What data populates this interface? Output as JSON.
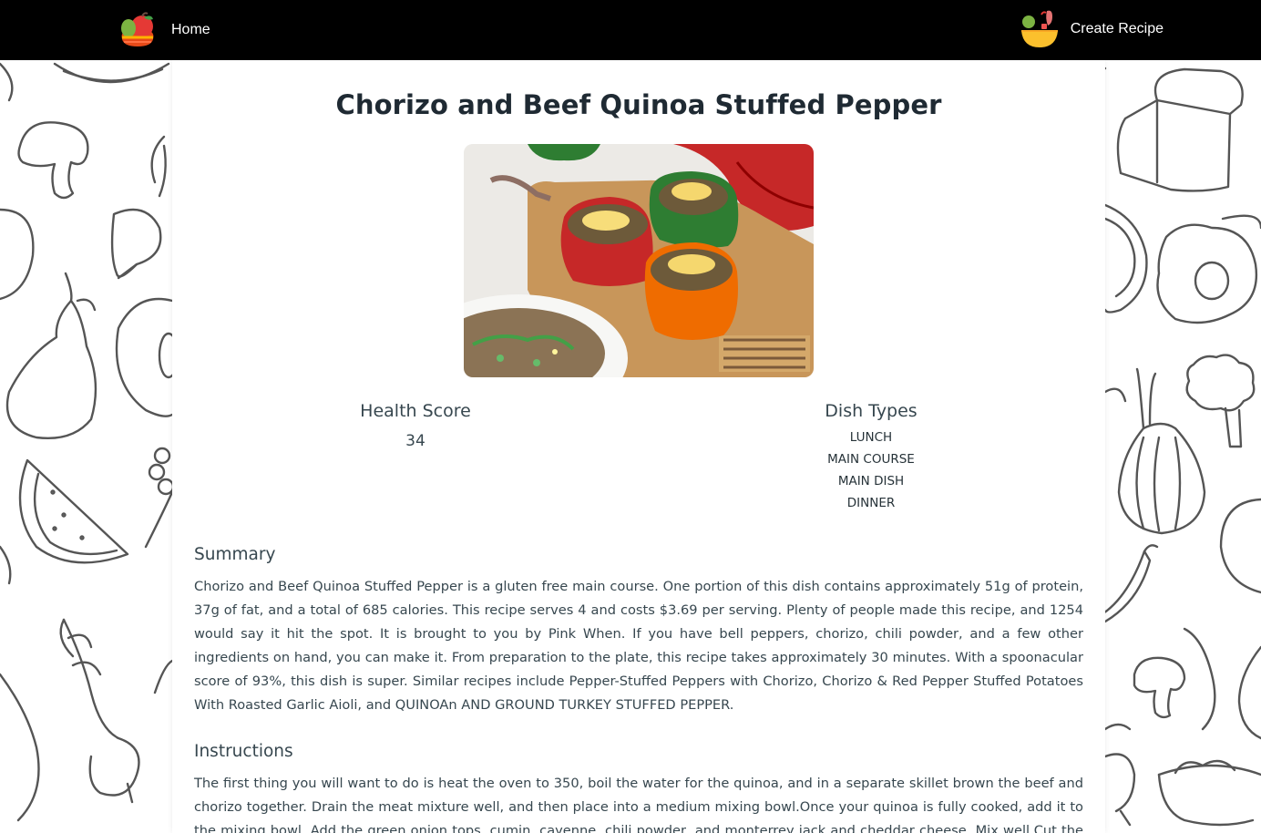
{
  "nav": {
    "home_label": "Home",
    "create_label": "Create Recipe"
  },
  "recipe": {
    "title": "Chorizo and Beef Quinoa Stuffed Pepper",
    "image_alt": "stuffed peppers",
    "health_score_label": "Health Score",
    "health_score": "34",
    "dish_types_label": "Dish Types",
    "dish_types": [
      "LUNCH",
      "MAIN COURSE",
      "MAIN DISH",
      "DINNER"
    ],
    "summary_label": "Summary",
    "summary": "Chorizo and Beef Quinoa Stuffed Pepper is a gluten free main course. One portion of this dish contains approximately 51g of protein, 37g of fat, and a total of 685 calories. This recipe serves 4 and costs $3.69 per serving. Plenty of people made this recipe, and 1254 would say it hit the spot. It is brought to you by Pink When. If you have bell peppers, chorizo, chili powder, and a few other ingredients on hand, you can make it. From preparation to the plate, this recipe takes approximately 30 minutes. With a spoonacular score of 93%, this dish is super. Similar recipes include Pepper-Stuffed Peppers with Chorizo, Chorizo & Red Pepper Stuffed Potatoes With Roasted Garlic Aioli, and QUINOAn AND GROUND TURKEY STUFFED PEPPER.",
    "instructions_label": "Instructions",
    "instructions": "The first thing you will want to do is heat the oven to 350, boil the water for the quinoa, and in a separate skillet brown the beef and chorizo together. Drain the meat mixture well, and then place into a medium mixing bowl.Once your quinoa is fully cooked, add it to the mixing bowl. Add the green onion tops, cumin, cayenne, chili powder, and monterrey jack and cheddar cheese. Mix well.Cut the tops from"
  },
  "icons": {
    "home_logo": "fruit-basket-icon",
    "create_recipe": "salad-bowl-icon"
  },
  "colors": {
    "navbar": "#000000",
    "card": "#ffffff",
    "doodle_stroke": "#555555"
  }
}
